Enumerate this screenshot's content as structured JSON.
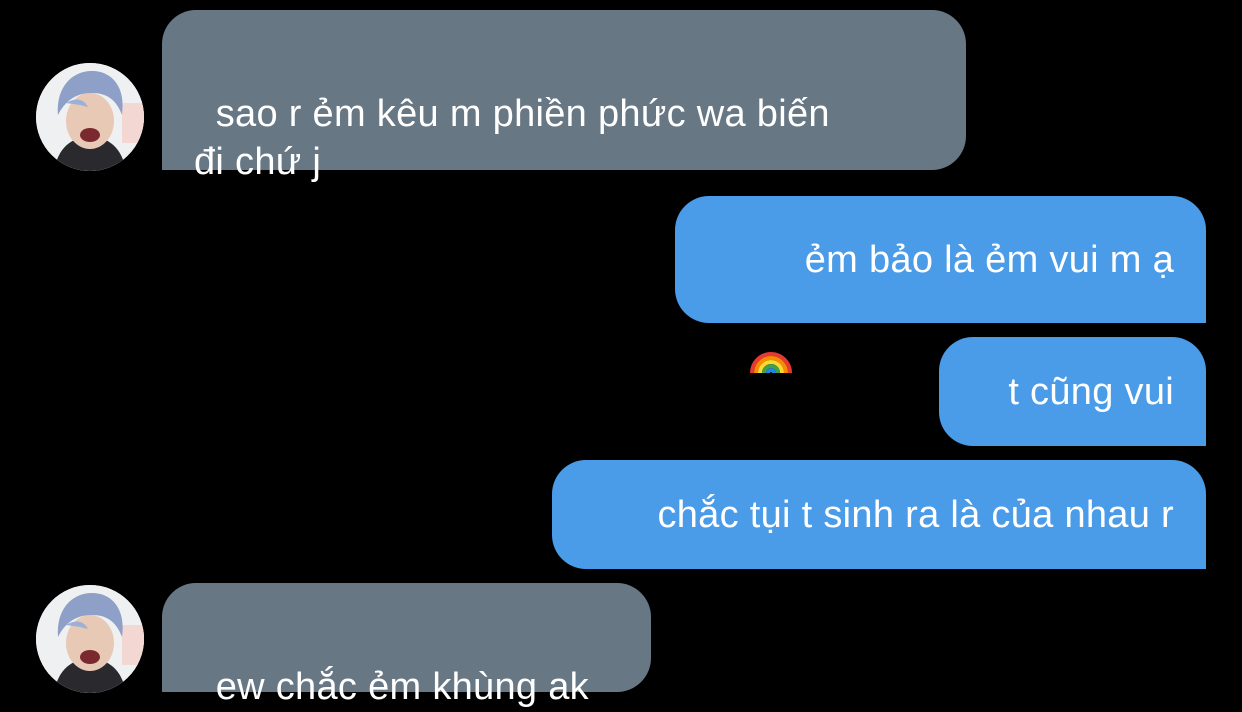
{
  "messages": [
    {
      "sender": "them",
      "text": "sao r ẻm kêu m phiền phức wa biến\nđi chứ j"
    },
    {
      "sender": "me",
      "icon": "rainbow-icon",
      "text": "ẻm bảo là ẻm vui m ạ"
    },
    {
      "sender": "me",
      "text": "t cũng vui"
    },
    {
      "sender": "me",
      "text": "chắc tụi t sinh ra là của nhau r"
    },
    {
      "sender": "them",
      "text": "ew chắc ẻm khùng ak"
    }
  ],
  "colors": {
    "background": "#000000",
    "received_bubble": "#687784",
    "sent_bubble": "#4a9be8",
    "text": "#ffffff"
  },
  "avatar_icon": "contact-photo"
}
